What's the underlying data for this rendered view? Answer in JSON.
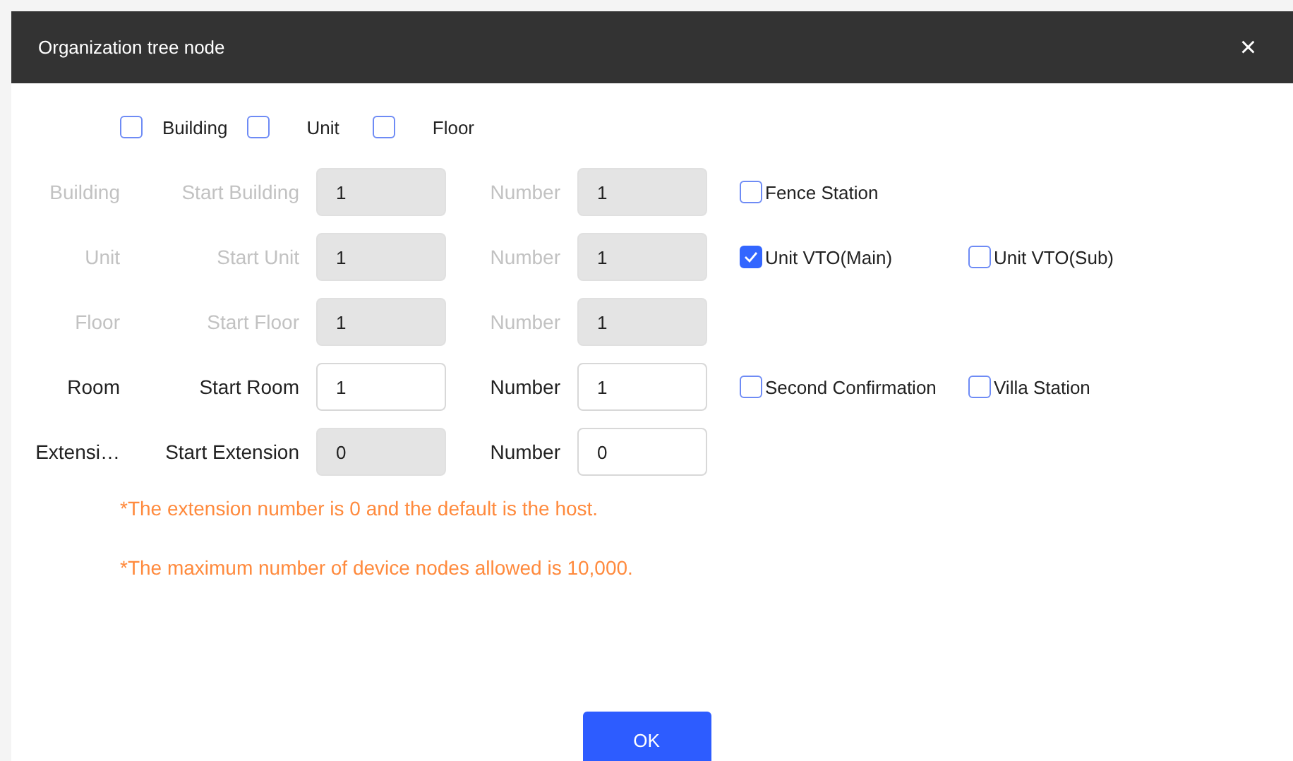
{
  "window": {
    "title": "Organization tree node",
    "close": "×"
  },
  "levels": [
    {
      "label": "Building",
      "checked": false
    },
    {
      "label": "Unit",
      "checked": false
    },
    {
      "label": "Floor",
      "checked": false
    }
  ],
  "rows": [
    {
      "label": "Building",
      "disabled": true,
      "start": {
        "label": "Start Building",
        "value": "1",
        "disabled": true
      },
      "number": {
        "label": "Number",
        "value": "1",
        "disabled": true
      },
      "options": [
        {
          "label": "Fence Station",
          "checked": false
        }
      ]
    },
    {
      "label": "Unit",
      "disabled": true,
      "start": {
        "label": "Start Unit",
        "value": "1",
        "disabled": true
      },
      "number": {
        "label": "Number",
        "value": "1",
        "disabled": true
      },
      "options": [
        {
          "label": "Unit VTO(Main)",
          "checked": true
        },
        {
          "label": "Unit VTO(Sub)",
          "checked": false
        }
      ]
    },
    {
      "label": "Floor",
      "disabled": true,
      "start": {
        "label": "Start Floor",
        "value": "1",
        "disabled": true
      },
      "number": {
        "label": "Number",
        "value": "1",
        "disabled": true
      },
      "options": []
    },
    {
      "label": "Room",
      "disabled": false,
      "start": {
        "label": "Start Room",
        "value": "1",
        "disabled": false
      },
      "number": {
        "label": "Number",
        "value": "1",
        "disabled": false
      },
      "options": [
        {
          "label": "Second Confirmation",
          "checked": false
        },
        {
          "label": "Villa Station",
          "checked": false
        }
      ]
    },
    {
      "label": "Extensi…",
      "disabled": false,
      "start": {
        "label": "Start Extension",
        "value": "0",
        "disabled": true
      },
      "number": {
        "label": "Number",
        "value": "0",
        "disabled": false
      },
      "options": []
    }
  ],
  "notes": [
    "*The extension number is 0 and the default is the host.",
    "*The maximum number of device nodes allowed is 10,000."
  ],
  "buttons": [
    "OK"
  ]
}
